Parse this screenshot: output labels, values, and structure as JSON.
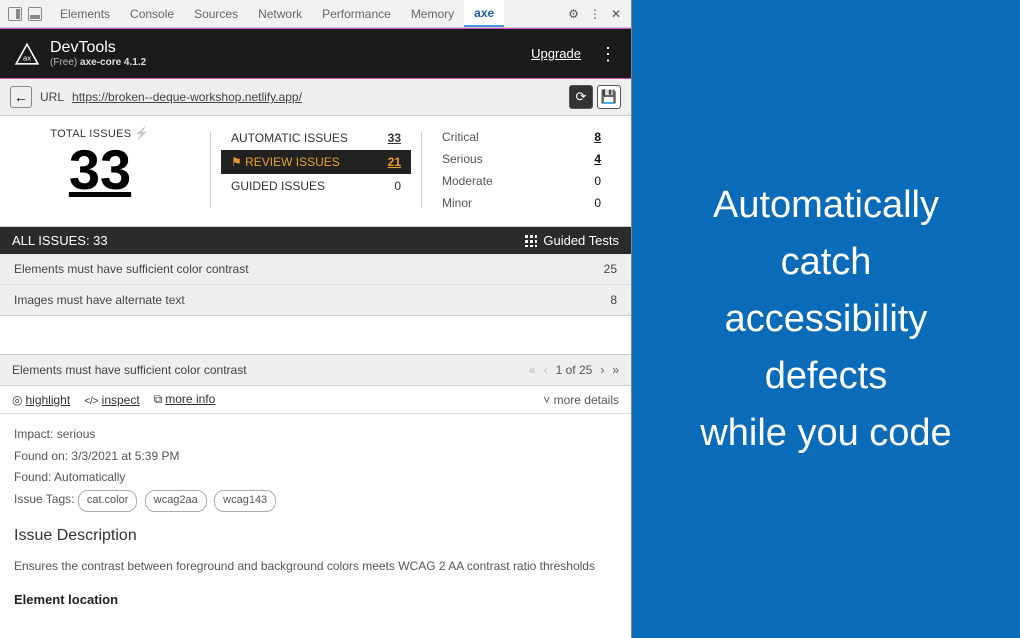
{
  "tabs": {
    "items": [
      "Elements",
      "Console",
      "Sources",
      "Network",
      "Performance",
      "Memory",
      "axe"
    ],
    "active_index": 6
  },
  "header": {
    "product": "DevTools",
    "tier": "(Free)",
    "engine": "axe-core 4.1.2",
    "upgrade": "Upgrade"
  },
  "urlbar": {
    "label": "URL",
    "url": "https://broken--deque-workshop.netlify.app/"
  },
  "summary": {
    "total_label": "TOTAL ISSUES",
    "total": "33",
    "types": [
      {
        "label": "AUTOMATIC ISSUES",
        "count": "33",
        "selected": false
      },
      {
        "label": "REVIEW ISSUES",
        "count": "21",
        "selected": true
      },
      {
        "label": "GUIDED ISSUES",
        "count": "0",
        "selected": false
      }
    ],
    "severity": [
      {
        "label": "Critical",
        "count": "8",
        "zero": false
      },
      {
        "label": "Serious",
        "count": "4",
        "zero": false
      },
      {
        "label": "Moderate",
        "count": "0",
        "zero": true
      },
      {
        "label": "Minor",
        "count": "0",
        "zero": true
      }
    ]
  },
  "darkbar": {
    "left": "ALL ISSUES: 33",
    "right": "Guided Tests"
  },
  "issues": [
    {
      "title": "Elements must have sufficient color contrast",
      "count": "25"
    },
    {
      "title": "Images must have alternate text",
      "count": "8"
    }
  ],
  "detail": {
    "title": "Elements must have sufficient color contrast",
    "pager": "1 of 25",
    "actions": {
      "highlight": "highlight",
      "inspect": "inspect",
      "more_info": "more info",
      "more_details": "more details"
    },
    "impact_label": "Impact:",
    "impact_value": "serious",
    "found_on_label": "Found on:",
    "found_on_value": "3/3/2021 at 5:39 PM",
    "found_label": "Found:",
    "found_value": "Automatically",
    "tags_label": "Issue Tags:",
    "tags": [
      "cat.color",
      "wcag2aa",
      "wcag143"
    ],
    "desc_heading": "Issue Description",
    "desc_body": "Ensures the contrast between foreground and background colors meets WCAG 2 AA contrast ratio thresholds",
    "loc_heading": "Element location"
  },
  "marketing": {
    "line1": "Automatically",
    "line2": "catch",
    "line3": "accessibility",
    "line4": "defects",
    "line5": "while you code"
  }
}
